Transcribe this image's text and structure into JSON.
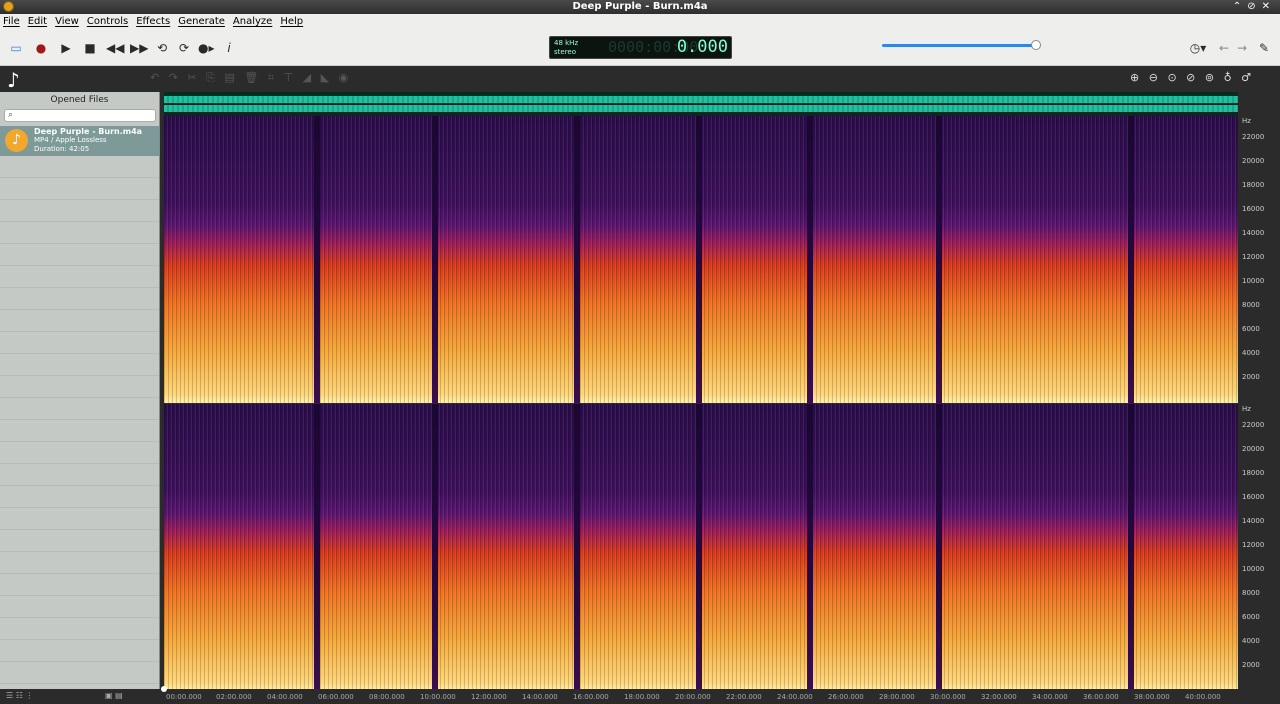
{
  "window": {
    "title": "Deep Purple - Burn.m4a"
  },
  "menu": [
    "File",
    "Edit",
    "View",
    "Controls",
    "Effects",
    "Generate",
    "Analyze",
    "Help"
  ],
  "toolbar": {
    "icons": [
      "spectrogram-view-icon",
      "record-icon",
      "play-icon",
      "stop-icon",
      "rewind-icon",
      "fast-forward-icon",
      "loop-icon",
      "repeat-icon",
      "skip-icon",
      "info-icon"
    ],
    "lcd": {
      "rate": "48 kHz",
      "channels": "stereo",
      "time": "0000:00:00",
      "seconds": "0.000"
    },
    "volume": 0.96
  },
  "sidebar": {
    "header": "Opened Files",
    "files": [
      {
        "name": "Deep Purple - Burn.m4a",
        "format": "MP4 / Apple Lossless",
        "duration": "Duration: 42:05"
      }
    ]
  },
  "spectrogram": {
    "hz_label": "Hz",
    "hz_ticks": [
      "22000",
      "20000",
      "18000",
      "16000",
      "14000",
      "12000",
      "10000",
      "8000",
      "6000",
      "4000",
      "2000"
    ],
    "time_ticks": [
      "00:00.000",
      "02:00.000",
      "04:00.000",
      "06:00.000",
      "08:00.000",
      "10:00.000",
      "12:00.000",
      "14:00.000",
      "16:00.000",
      "18:00.000",
      "20:00.000",
      "22:00.000",
      "24:00.000",
      "26:00.000",
      "28:00.000",
      "30:00.000",
      "32:00.000",
      "34:00.000",
      "36:00.000",
      "38:00.000",
      "40:00.000"
    ]
  }
}
